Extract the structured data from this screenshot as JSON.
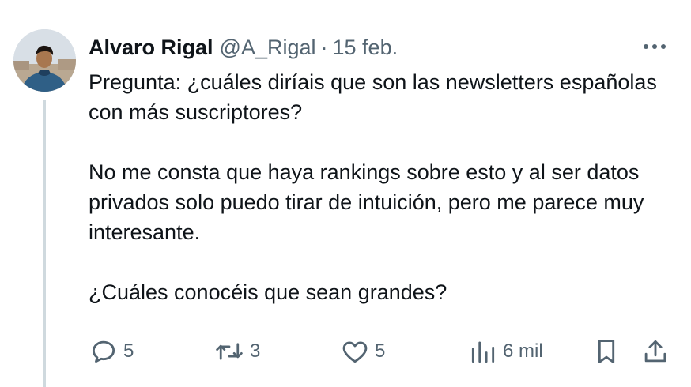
{
  "author": {
    "name": "Alvaro Rigal",
    "handle": "@A_Rigal",
    "separator": "·",
    "date": "15 feb."
  },
  "tweet": {
    "paragraphs": [
      "Pregunta: ¿cuáles diríais que son las newsletters españolas con más suscriptores?",
      "No me consta que haya rankings sobre esto y al ser datos privados solo puedo tirar de intuición, pero me parece muy interesante.",
      "¿Cuáles conocéis que sean grandes?"
    ]
  },
  "actions": {
    "replies": "5",
    "retweets": "3",
    "likes": "5",
    "views": "6 mil"
  },
  "colors": {
    "text": "#0f1419",
    "secondary": "#536471",
    "thread_line": "#cfd9de"
  },
  "icons": [
    "more-icon",
    "reply-icon",
    "retweet-icon",
    "like-icon",
    "views-icon",
    "bookmark-icon",
    "share-icon"
  ]
}
